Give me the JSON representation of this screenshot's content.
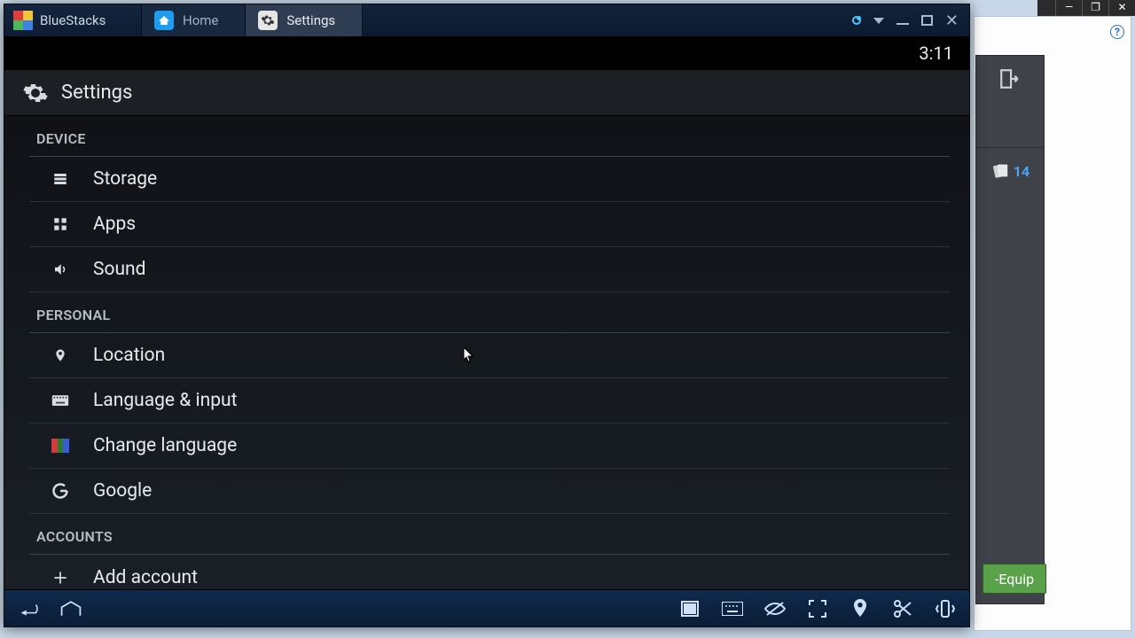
{
  "outer_window": {
    "buttons": {
      "min": "—",
      "max": "❐",
      "close": "✕"
    },
    "help": "?"
  },
  "side_panel": {
    "badge_count": "14",
    "equip_label": "-Equip"
  },
  "bluestacks": {
    "brand": "BlueStacks",
    "tabs": [
      {
        "label": "Home",
        "active": false
      },
      {
        "label": "Settings",
        "active": true
      }
    ]
  },
  "android_status": {
    "time": "3:11"
  },
  "settings": {
    "title": "Settings",
    "sections": [
      {
        "header": "DEVICE",
        "items": [
          {
            "icon": "storage-icon",
            "label": "Storage"
          },
          {
            "icon": "apps-icon",
            "label": "Apps"
          },
          {
            "icon": "sound-icon",
            "label": "Sound"
          }
        ]
      },
      {
        "header": "PERSONAL",
        "items": [
          {
            "icon": "location-icon",
            "label": "Location"
          },
          {
            "icon": "keyboard-icon",
            "label": "Language & input"
          },
          {
            "icon": "language-flag-icon",
            "label": "Change language"
          },
          {
            "icon": "google-icon",
            "label": "Google"
          }
        ]
      },
      {
        "header": "ACCOUNTS",
        "items": [
          {
            "icon": "plus-icon",
            "label": "Add account"
          }
        ]
      }
    ]
  }
}
